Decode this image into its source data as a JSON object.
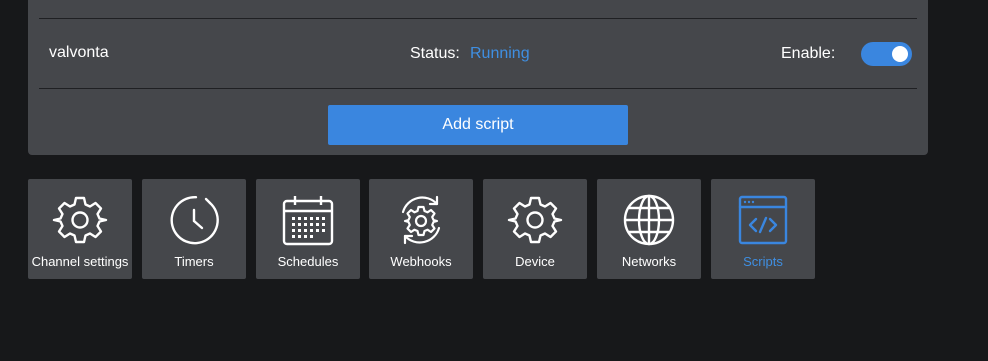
{
  "script": {
    "name": "valvonta",
    "status_label": "Status:",
    "status_value": "Running",
    "enable_label": "Enable:",
    "enabled": true
  },
  "add_button_label": "Add script",
  "colors": {
    "accent": "#3a86df",
    "status_running": "#3f8fe2",
    "panel": "#45474b",
    "background": "#17181a"
  },
  "nav": {
    "items": [
      {
        "label": "Channel settings",
        "icon": "gear-icon",
        "active": false
      },
      {
        "label": "Timers",
        "icon": "stopwatch-icon",
        "active": false
      },
      {
        "label": "Schedules",
        "icon": "calendar-icon",
        "active": false
      },
      {
        "label": "Webhooks",
        "icon": "webhook-gear-icon",
        "active": false
      },
      {
        "label": "Device",
        "icon": "gear-icon",
        "active": false
      },
      {
        "label": "Networks",
        "icon": "globe-icon",
        "active": false
      },
      {
        "label": "Scripts",
        "icon": "code-window-icon",
        "active": true
      }
    ]
  }
}
